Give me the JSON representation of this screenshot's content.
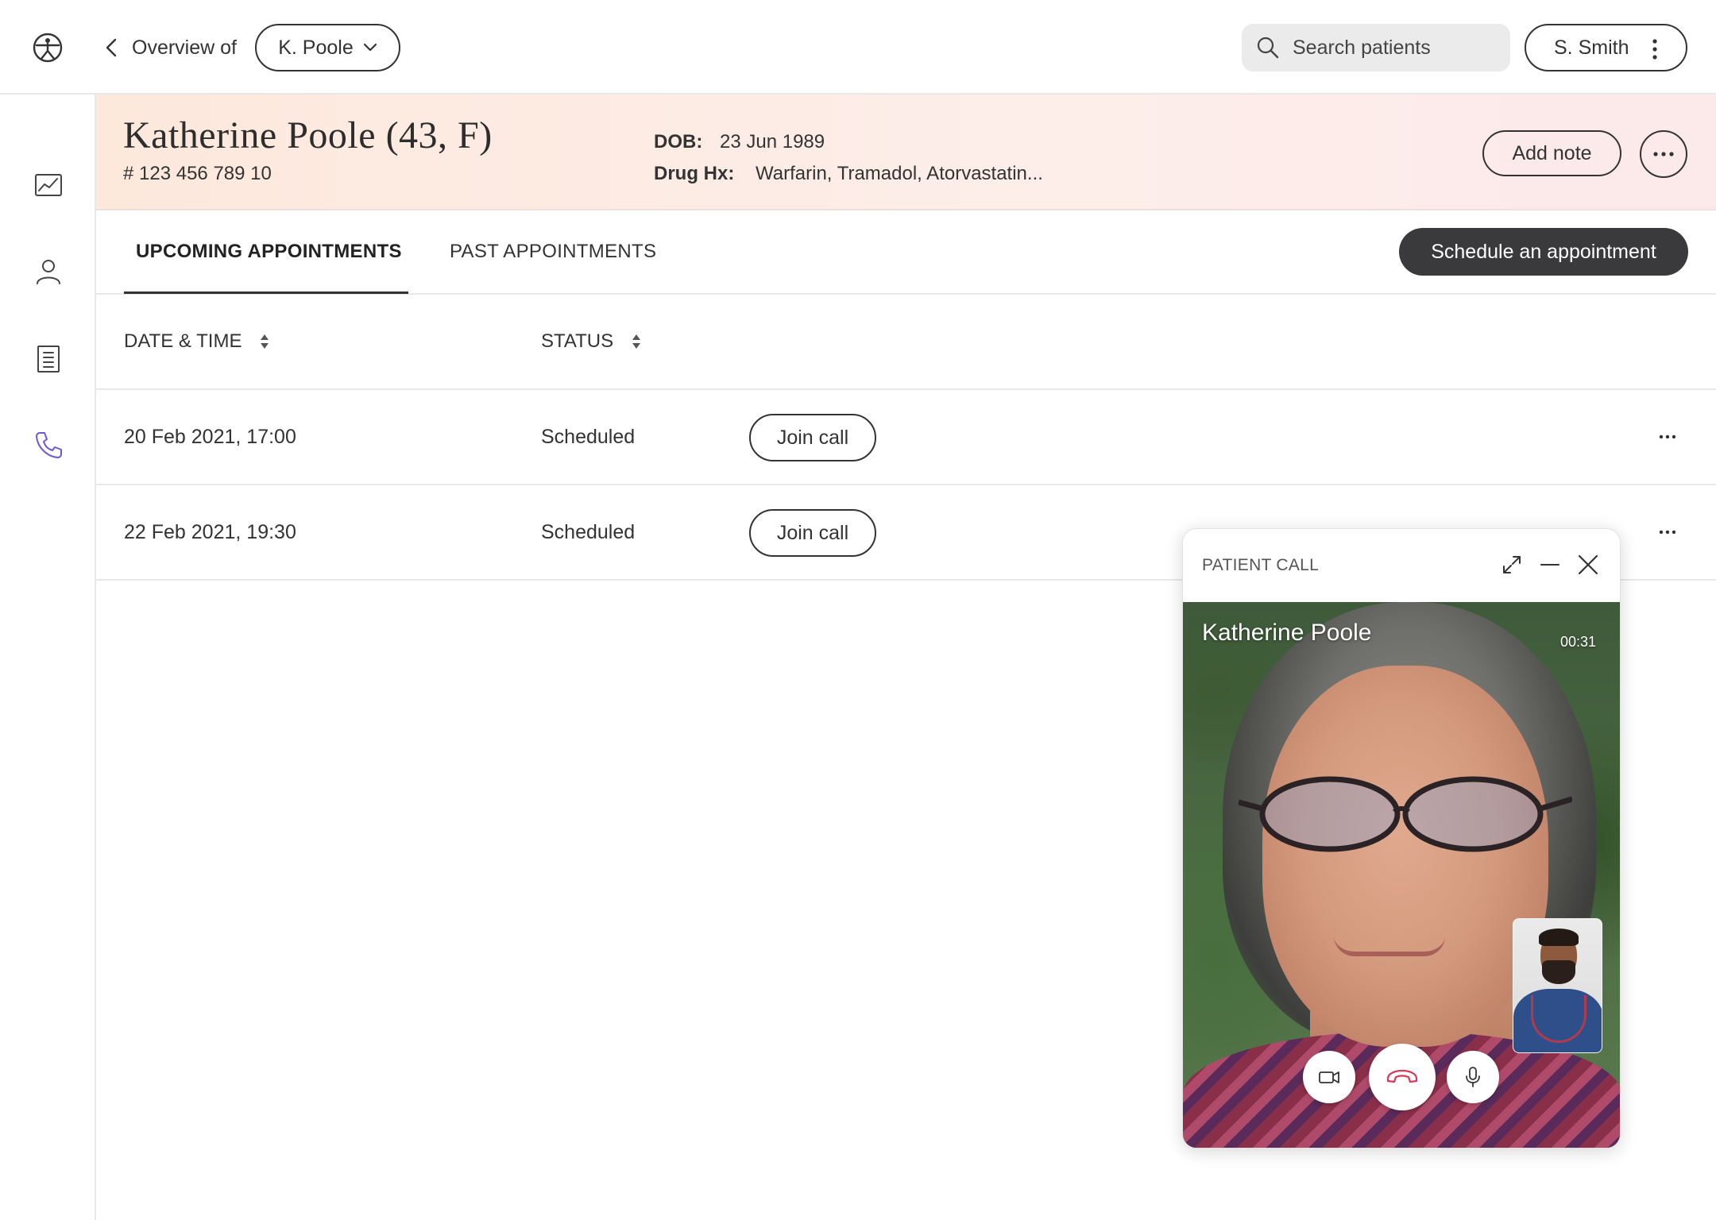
{
  "topbar": {
    "back_label": "Overview of",
    "patient_selector": "K. Poole",
    "search_placeholder": "Search patients",
    "user_name": "S. Smith"
  },
  "sidebar": {
    "items": [
      {
        "name": "analytics",
        "icon": "chart-icon"
      },
      {
        "name": "patients",
        "icon": "person-icon"
      },
      {
        "name": "records",
        "icon": "document-icon"
      },
      {
        "name": "calls",
        "icon": "phone-icon",
        "active": true
      }
    ]
  },
  "patient": {
    "name": "Katherine Poole (43, F)",
    "id": "# 123 456 789 10",
    "dob_label": "DOB:",
    "dob": "23 Jun 1989",
    "drug_label": "Drug Hx:",
    "drugs": "Warfarin, Tramadol, Atorvastatin...",
    "add_note_label": "Add note"
  },
  "tabs": {
    "upcoming": "UPCOMING APPOINTMENTS",
    "past": "PAST APPOINTMENTS",
    "schedule_label": "Schedule an appointment"
  },
  "table": {
    "headers": {
      "datetime": "DATE & TIME",
      "status": "STATUS"
    },
    "rows": [
      {
        "datetime": "20 Feb 2021, 17:00",
        "status": "Scheduled",
        "action": "Join call"
      },
      {
        "datetime": "22 Feb 2021, 19:30",
        "status": "Scheduled",
        "action": "Join call"
      }
    ]
  },
  "call": {
    "title": "PATIENT CALL",
    "caller": "Katherine Poole",
    "timer": "00:31"
  },
  "colors": {
    "accent": "#6b5bd6",
    "hangup": "#d63a5a",
    "dark_button": "#3a3a3c"
  }
}
